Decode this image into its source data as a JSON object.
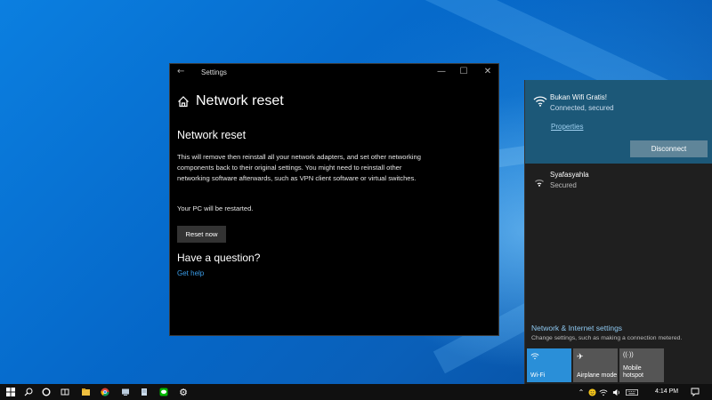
{
  "settings_window": {
    "title": "Settings",
    "page_title": "Network reset",
    "section_title": "Network reset",
    "description": "This will remove then reinstall all your network adapters, and set other networking components back to their original settings. You might need to reinstall other networking software afterwards, such as VPN client software or virtual switches.",
    "restart_note": "Your PC will be restarted.",
    "reset_button": "Reset now",
    "question_heading": "Have a question?",
    "help_link": "Get help"
  },
  "network_flyout": {
    "networks": [
      {
        "name": "Bukan Wifi Gratis!",
        "status": "Connected, secured",
        "properties_link": "Properties",
        "disconnect_button": "Disconnect"
      },
      {
        "name": "Syafasyahla",
        "status": "Secured"
      }
    ],
    "settings_link": "Network & Internet settings",
    "settings_desc": "Change settings, such as making a connection metered.",
    "tiles": [
      {
        "label": "Wi-Fi",
        "icon": "wifi-icon",
        "active": true
      },
      {
        "label": "Airplane mode",
        "icon": "airplane-icon",
        "active": false
      },
      {
        "label": "Mobile hotspot",
        "icon": "hotspot-icon",
        "active": false
      }
    ]
  },
  "taskbar": {
    "time": "4:14 PM",
    "apps": [
      "windows-start-icon",
      "search-icon",
      "cortana-icon",
      "task-view-icon",
      "file-explorer-icon",
      "chrome-icon",
      "app-icon",
      "notepad-icon",
      "line-icon",
      "settings-icon"
    ],
    "tray": [
      "chevron-up-icon",
      "emoji-icon",
      "wifi-icon",
      "volume-icon",
      "keyboard-icon",
      "notification-icon"
    ]
  },
  "colors": {
    "accent": "#2a8fd8",
    "active_network_bg": "#1c5878",
    "link": "#3a9ce8"
  }
}
